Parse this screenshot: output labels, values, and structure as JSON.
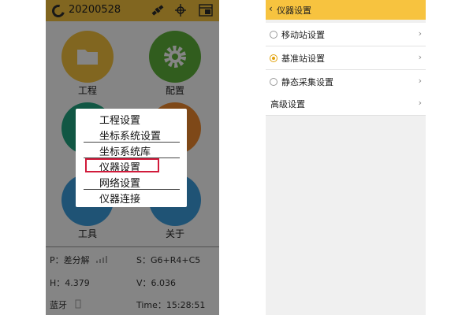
{
  "left_screen": {
    "header": {
      "project_name": "20200528"
    },
    "tiles": [
      {
        "label": "工程",
        "color": "#f7c33f"
      },
      {
        "label": "配置",
        "color": "#5fb23a"
      },
      {
        "label": "",
        "color": "#22a882"
      },
      {
        "label": "",
        "color": "#f28b2e"
      },
      {
        "label": "工具",
        "color": "#3ca0e0"
      },
      {
        "label": "关于",
        "color": "#3ca0e0"
      }
    ],
    "status": {
      "p": "P：差分解",
      "s": "S：G6+R4+C5",
      "h": "H：4.379",
      "v": "V：6.036",
      "bluetooth": "蓝牙",
      "time": "Time：15:28:51"
    },
    "menu": {
      "items": [
        "工程设置",
        "坐标系统设置",
        "坐标系统库",
        "仪器设置",
        "网络设置",
        "仪器连接"
      ],
      "highlighted": "仪器设置"
    }
  },
  "right_screen": {
    "header": {
      "back_arrow": "‹",
      "title": "仪器设置"
    },
    "chevron": "›",
    "options": [
      {
        "label": "移动站设置",
        "selected": false
      },
      {
        "label": "基准站设置",
        "selected": true
      },
      {
        "label": "静态采集设置",
        "selected": false
      }
    ],
    "advanced": "高级设置"
  },
  "colors": {
    "accent": "#f7c33f",
    "highlight": "#d11b3b",
    "radio_on": "#e2a20c"
  }
}
